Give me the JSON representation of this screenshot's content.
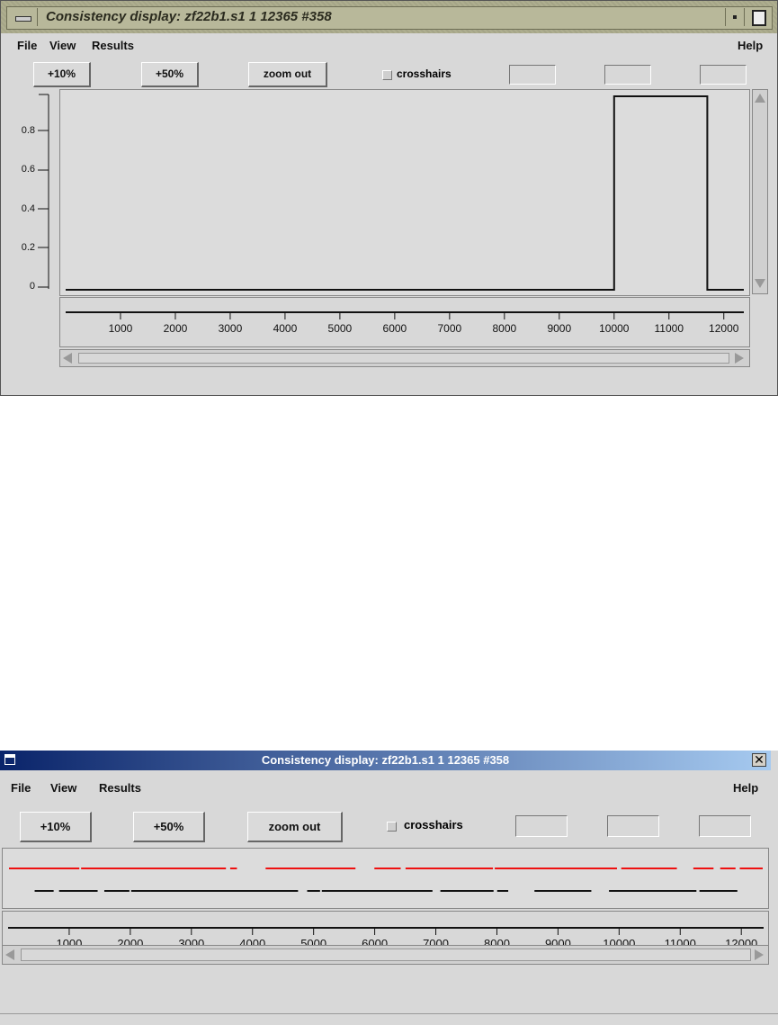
{
  "window1": {
    "title": "Consistency display: zf22b1.s1 1 12365 #358",
    "menu": {
      "file": "File",
      "view": "View",
      "results": "Results",
      "help": "Help"
    },
    "toolbar": {
      "plus10": "+10%",
      "plus50": "+50%",
      "zoom_out": "zoom out",
      "crosshairs": "crosshairs"
    },
    "y_ticks": [
      "0.8",
      "0.6",
      "0.4",
      "0.2",
      "0"
    ],
    "x_ticks": [
      "1000",
      "2000",
      "3000",
      "4000",
      "5000",
      "6000",
      "7000",
      "8000",
      "9000",
      "10000",
      "11000",
      "12000"
    ]
  },
  "window2": {
    "title": "Consistency display: zf22b1.s1 1 12365 #358",
    "menu": {
      "file": "File",
      "view": "View",
      "results": "Results",
      "help": "Help"
    },
    "toolbar": {
      "plus10": "+10%",
      "plus50": "+50%",
      "zoom_out": "zoom out",
      "crosshairs": "crosshairs"
    },
    "x_ticks": [
      "1000",
      "2000",
      "3000",
      "4000",
      "5000",
      "6000",
      "7000",
      "8000",
      "9000",
      "10000",
      "11000",
      "12000"
    ]
  },
  "chart_data": [
    {
      "type": "line",
      "xlim": [
        0,
        12365
      ],
      "ylim": [
        0,
        1
      ],
      "x": [
        0,
        10000,
        10000,
        11700,
        11700,
        12365
      ],
      "y": [
        0,
        0,
        1,
        1,
        0,
        0
      ]
    },
    {
      "type": "segments",
      "xlim": [
        0,
        12365
      ],
      "series": [
        {
          "color": "#ee1111",
          "segments": [
            [
              0,
              1180
            ],
            [
              1180,
              3580
            ],
            [
              3620,
              3760
            ],
            [
              4200,
              5700
            ],
            [
              5980,
              6440
            ],
            [
              6490,
              7950
            ],
            [
              7950,
              9980
            ],
            [
              10020,
              10960
            ],
            [
              11200,
              11560
            ],
            [
              11640,
              11920
            ],
            [
              11960,
              12365
            ]
          ]
        },
        {
          "color": "#111111",
          "segments": [
            [
              420,
              760
            ],
            [
              820,
              1480
            ],
            [
              1560,
              2000
            ],
            [
              2000,
              4760
            ],
            [
              4880,
              5120
            ],
            [
              5120,
              6960
            ],
            [
              7060,
              7960
            ],
            [
              7990,
              8200
            ],
            [
              8600,
              9560
            ],
            [
              9820,
              11280
            ],
            [
              11300,
              11950
            ]
          ]
        }
      ]
    }
  ]
}
